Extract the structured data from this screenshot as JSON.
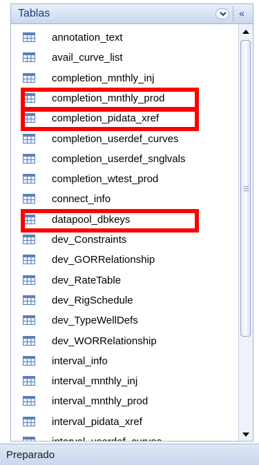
{
  "pane": {
    "title": "Tablas",
    "dropdown_icon": "chevron-down-icon",
    "collapse_glyph": "«"
  },
  "tables": [
    {
      "label": "annotation_text",
      "highlighted": false
    },
    {
      "label": "avail_curve_list",
      "highlighted": false
    },
    {
      "label": "completion_mnthly_inj",
      "highlighted": false
    },
    {
      "label": "completion_mnthly_prod",
      "highlighted": true
    },
    {
      "label": "completion_pidata_xref",
      "highlighted": true
    },
    {
      "label": "completion_userdef_curves",
      "highlighted": false
    },
    {
      "label": "completion_userdef_snglvals",
      "highlighted": false
    },
    {
      "label": "completion_wtest_prod",
      "highlighted": false
    },
    {
      "label": "connect_info",
      "highlighted": false
    },
    {
      "label": "datapool_dbkeys",
      "highlighted": true
    },
    {
      "label": "dev_Constraints",
      "highlighted": false
    },
    {
      "label": "dev_GORRelationship",
      "highlighted": false
    },
    {
      "label": "dev_RateTable",
      "highlighted": false
    },
    {
      "label": "dev_RigSchedule",
      "highlighted": false
    },
    {
      "label": "dev_TypeWellDefs",
      "highlighted": false
    },
    {
      "label": "dev_WORRelationship",
      "highlighted": false
    },
    {
      "label": "interval_info",
      "highlighted": false
    },
    {
      "label": "interval_mnthly_inj",
      "highlighted": false
    },
    {
      "label": "interval_mnthly_prod",
      "highlighted": false
    },
    {
      "label": "interval_pidata_xref",
      "highlighted": false
    },
    {
      "label": "interval_userdef_curves",
      "highlighted": false
    }
  ],
  "status": {
    "text": "Preparado"
  },
  "colors": {
    "highlight": "#ff0000",
    "header_text": "#1f3e7a",
    "table_icon": "#5b7fb8"
  }
}
